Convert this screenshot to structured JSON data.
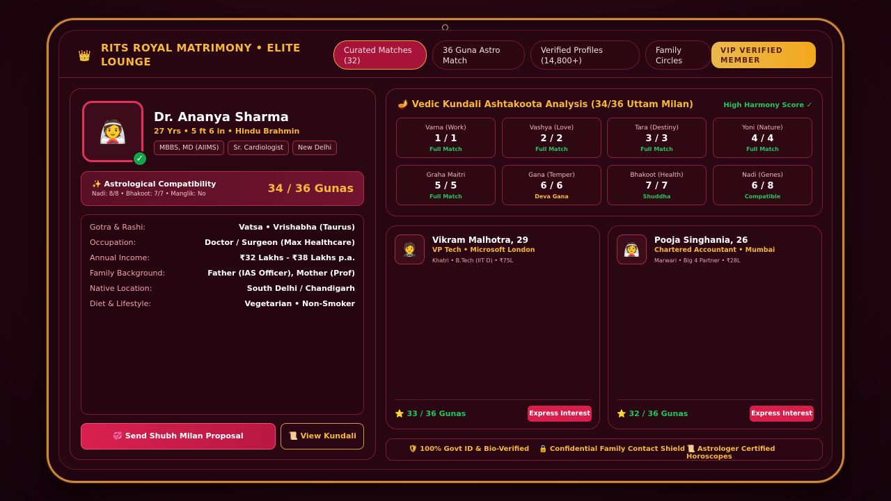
{
  "header": {
    "brand": "RITS ROYAL MATRIMONY • ELITE LOUNGE",
    "tabs": [
      {
        "label": "Curated Matches (32)",
        "active": true
      },
      {
        "label": "36 Guna Astro Match",
        "active": false
      },
      {
        "label": "Verified Profiles (14,800+)",
        "active": false
      },
      {
        "label": "Family Circles",
        "active": false
      }
    ],
    "badge": "VIP VERIFIED MEMBER"
  },
  "profile": {
    "name": "Dr. Ananya Sharma",
    "meta": "27 Yrs • 5 ft 6 in • Hindu Brahmin",
    "chips": [
      "MBBS, MD (AIIMS)",
      "Sr. Cardiologist",
      "New Delhi"
    ],
    "avatar_emoji": "👰",
    "compat": {
      "title": "✨ Astrological Compatibility",
      "sub": "Nadi: 8/8 • Bhakoot: 7/7 • Manglik: No",
      "score": "34 / 36 Gunas"
    },
    "details": [
      {
        "k": "Gotra & Rashi:",
        "v": "Vatsa • Vrishabha (Taurus)"
      },
      {
        "k": "Occupation:",
        "v": "Doctor / Surgeon (Max Healthcare)"
      },
      {
        "k": "Annual Income:",
        "v": "₹32 Lakhs - ₹38 Lakhs p.a."
      },
      {
        "k": "Family Background:",
        "v": "Father (IAS Officer), Mother (Prof)"
      },
      {
        "k": "Native Location:",
        "v": "South Delhi / Chandigarh"
      },
      {
        "k": "Diet & Lifestyle:",
        "v": "Vegetarian • Non-Smoker"
      }
    ],
    "primary_btn": "💞 Send Shubh Milan Proposal",
    "secondary_btn": "📜 View Kundali"
  },
  "kundali": {
    "title": "🪔 Vedic Kundali Ashtakoota Analysis (34/36 Uttam Milan)",
    "score_label": "High Harmony Score ✓",
    "cells": [
      {
        "label": "Varna (Work)",
        "value": "1 / 1",
        "status": "Full Match"
      },
      {
        "label": "Vashya (Love)",
        "value": "2 / 2",
        "status": "Full Match"
      },
      {
        "label": "Tara (Destiny)",
        "value": "3 / 3",
        "status": "Full Match"
      },
      {
        "label": "Yoni (Nature)",
        "value": "4 / 4",
        "status": "Full Match"
      },
      {
        "label": "Graha Maitri",
        "value": "5 / 5",
        "status": "Full Match"
      },
      {
        "label": "Gana (Temper)",
        "value": "6 / 6",
        "status": "Deva Gana"
      },
      {
        "label": "Bhakoot (Health)",
        "value": "7 / 7",
        "status": "Shuddha"
      },
      {
        "label": "Nadi (Genes)",
        "value": "6 / 8",
        "status": "Compatible"
      }
    ]
  },
  "matches": [
    {
      "name": "Vikram Malhotra, 29",
      "job": "VP Tech • Microsoft London",
      "meta": "Khatri • B.Tech (IIT D) • ₹75L",
      "score": "⭐ 33 / 36 Gunas",
      "btn": "Express Interest",
      "emoji": "🤵"
    },
    {
      "name": "Pooja Singhania, 26",
      "job": "Chartered Accountant • Mumbai",
      "meta": "Marwari • Big 4 Partner • ₹28L",
      "score": "⭐ 32 / 36 Gunas",
      "btn": "Express Interest",
      "emoji": "👰"
    }
  ],
  "trust": [
    "🛡 100% Govt ID & Bio-Verified",
    "🔒 Confidential Family Contact Shield",
    "📜 Astrologer Certified Horoscopes"
  ],
  "colors": {
    "gold": "#f6b83b",
    "crimson": "#d81f4c",
    "green": "#22c55e",
    "bg": "#280712"
  }
}
